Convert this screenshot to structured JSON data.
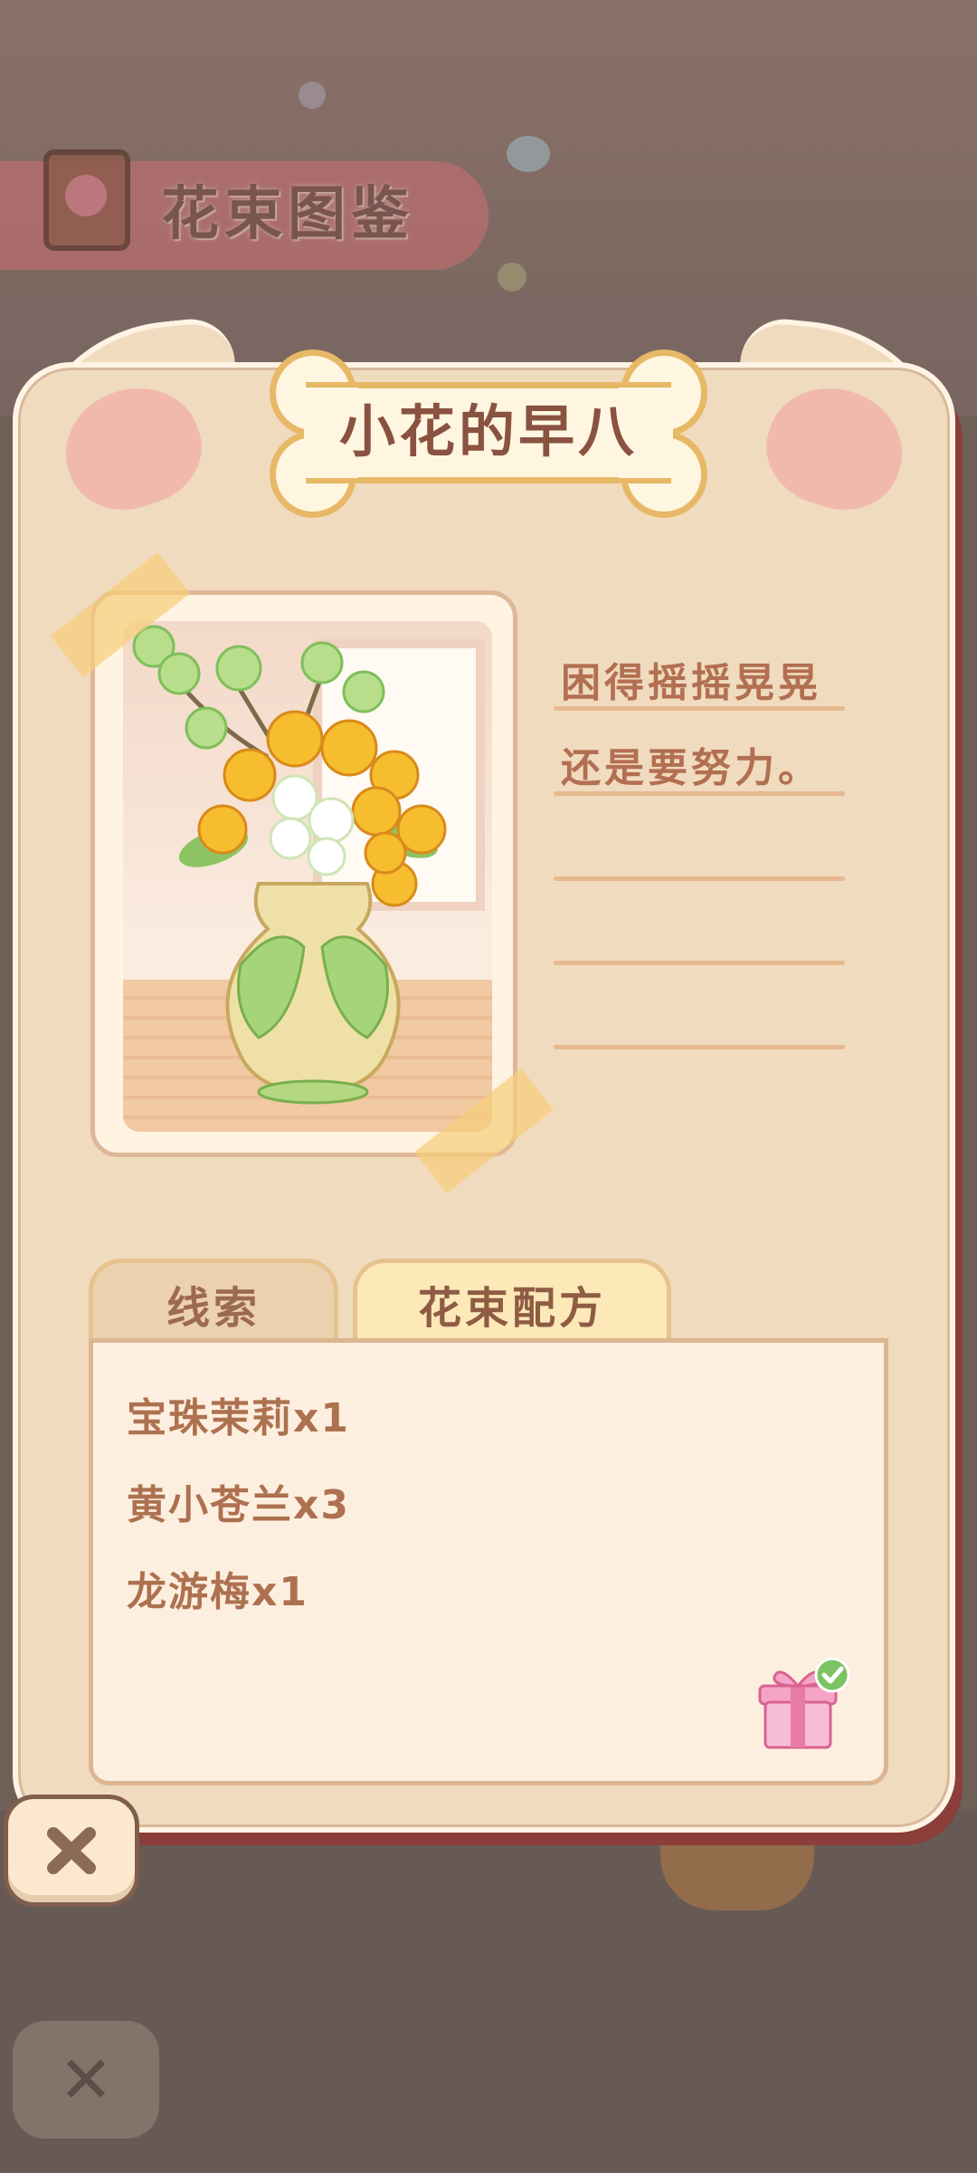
{
  "background": {
    "title": "花束图鉴"
  },
  "card": {
    "title": "小花的早八",
    "note_lines": [
      "困得摇摇晃晃",
      "还是要努力。",
      "",
      "",
      ""
    ]
  },
  "tabs": [
    {
      "label": "线索",
      "active": false
    },
    {
      "label": "花束配方",
      "active": true
    }
  ],
  "recipe": {
    "ingredients": [
      "宝珠茉莉x1",
      "黄小苍兰x3",
      "龙游梅x1"
    ]
  },
  "icons": {
    "close": "close-icon",
    "gift": "gift-icon",
    "check": "check-badge-icon",
    "book": "album-book-icon"
  },
  "colors": {
    "card_bg": "#f0dbbf",
    "title_text": "#8a5240",
    "accent_pink": "#f1b9ad",
    "check_green": "#7cc463"
  }
}
